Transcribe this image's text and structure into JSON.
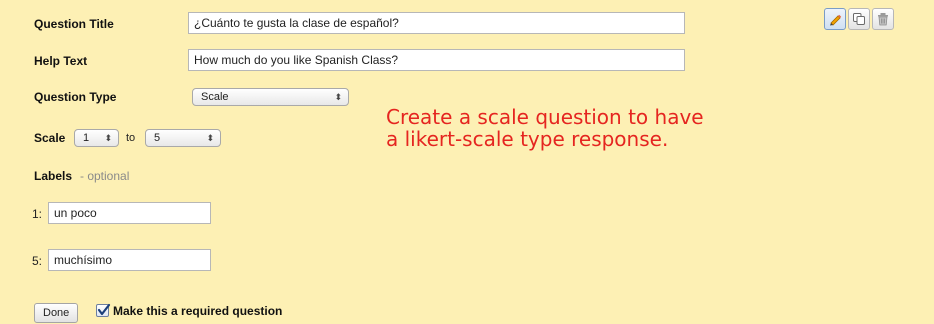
{
  "question": {
    "title_label": "Question Title",
    "title_value": "¿Cuánto te gusta la clase de español?",
    "help_label": "Help Text",
    "help_value": "How much do you like Spanish Class?",
    "type_label": "Question Type",
    "type_value": "Scale"
  },
  "scale": {
    "label": "Scale",
    "from_value": "1",
    "to_label": "to",
    "to_value": "5"
  },
  "labels": {
    "heading": "Labels",
    "optional": "- optional",
    "low_prefix": "1:",
    "low_value": "un poco",
    "high_prefix": "5:",
    "high_value": "muchísimo"
  },
  "annotation": {
    "line1": "Create a scale question to have",
    "line2": "a likert-scale type response."
  },
  "footer": {
    "done_label": "Done",
    "required_label": "Make this a required question",
    "required_checked": true
  },
  "toolbar": {
    "icons": [
      "pencil-icon",
      "copy-icon",
      "trash-icon"
    ]
  },
  "colors": {
    "panel_background": "#fdf0b4",
    "annotation_text": "#e52520"
  }
}
